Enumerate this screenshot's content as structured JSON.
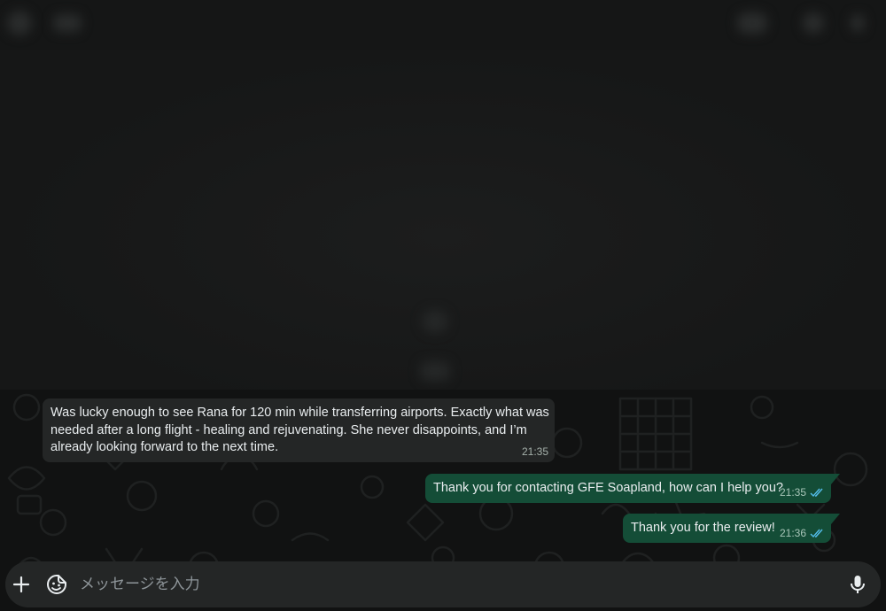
{
  "messages": [
    {
      "direction": "incoming",
      "lines": [
        "Was lucky enough to see Rana for 120 min while transferring airports. Exactly what was",
        "needed after a long flight - healing and rejuvenating. She never disappoints, and I’m",
        "already looking forward to the next time."
      ],
      "time": "21:35"
    },
    {
      "direction": "outgoing",
      "text": "Thank you for contacting GFE Soapland, how can I help you?",
      "time": "21:35",
      "status": "read"
    },
    {
      "direction": "outgoing",
      "text": "Thank you for the review!",
      "time": "21:36",
      "status": "read"
    }
  ],
  "composer": {
    "placeholder": "メッセージを入力",
    "left_icons": [
      "plus-icon",
      "sticker-icon"
    ],
    "right_icon": "microphone-icon"
  },
  "colors": {
    "incoming_bubble": "#242626",
    "outgoing_bubble": "#144d37",
    "read_ticks": "#53bdeb",
    "background": "#161717"
  }
}
